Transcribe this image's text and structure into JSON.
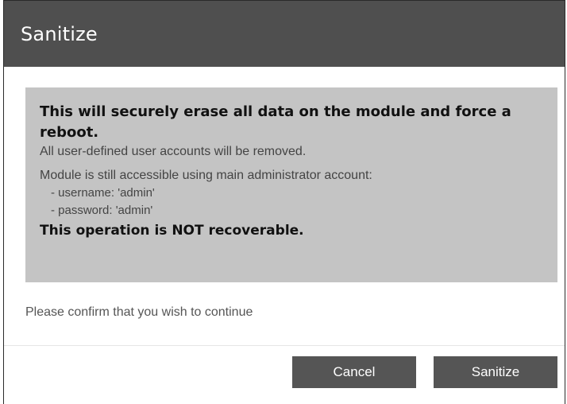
{
  "dialog": {
    "title": "Sanitize"
  },
  "warning": {
    "headline": "This will securely erase all data on the module and force a reboot.",
    "line1": "All user-defined user accounts will be removed.",
    "line2": "Module is still accessible using main administrator account:",
    "username_line": "- username: 'admin'",
    "password_line": "- password: 'admin'",
    "footer": "This operation is NOT recoverable."
  },
  "confirm": {
    "text": "Please confirm that you wish to continue"
  },
  "buttons": {
    "cancel_label": "Cancel",
    "sanitize_label": "Sanitize"
  },
  "colors": {
    "header_bg": "#4f4f4f",
    "warning_bg": "#c4c4c4",
    "button_bg": "#555555"
  }
}
